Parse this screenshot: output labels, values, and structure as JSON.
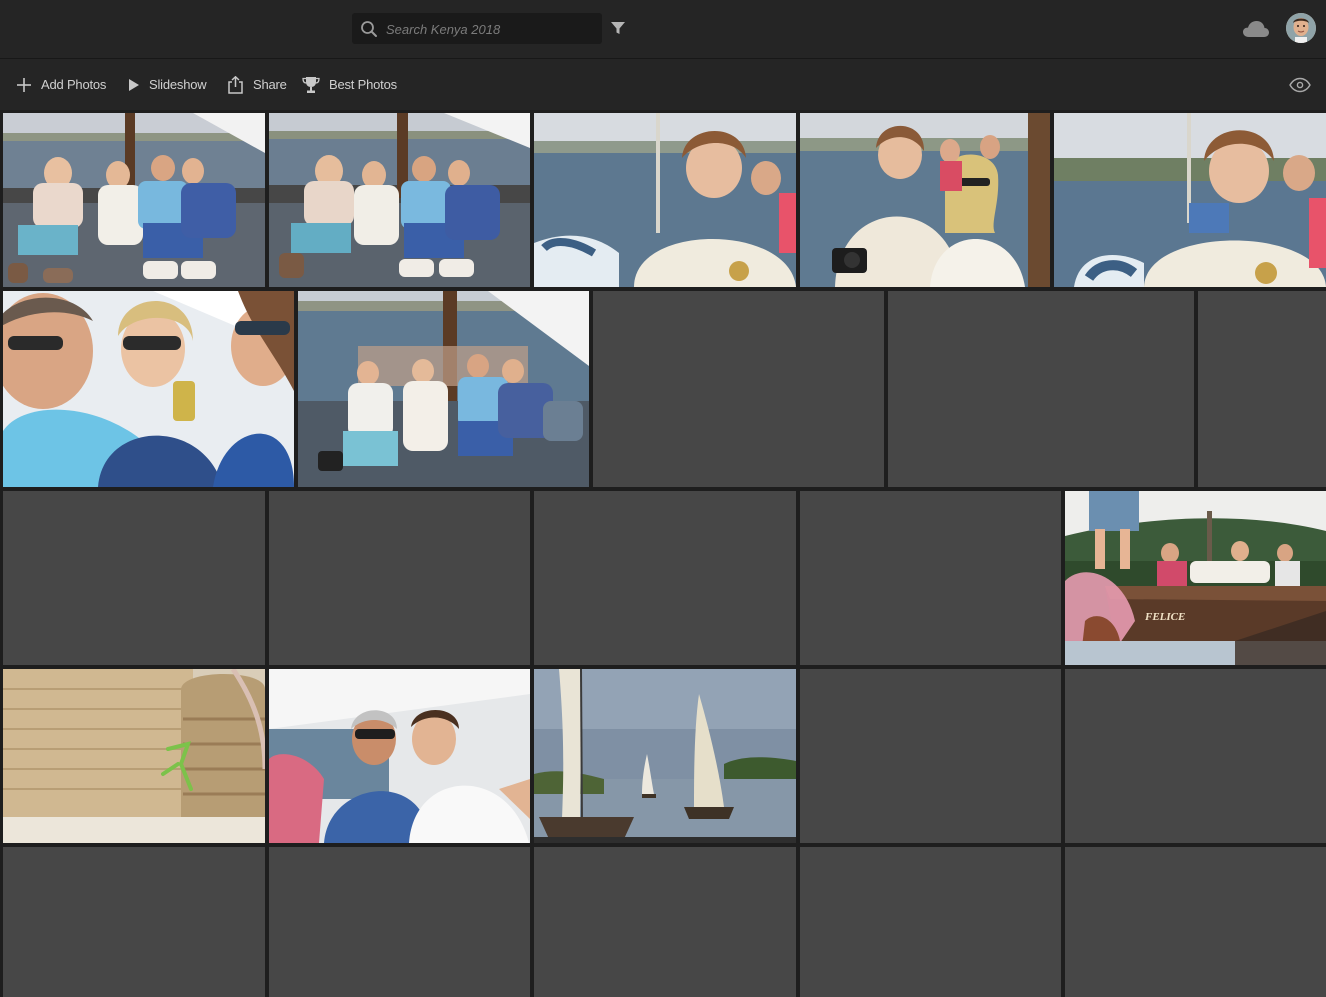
{
  "search": {
    "placeholder": "Search Kenya 2018",
    "value": ""
  },
  "topbar": {
    "filter_icon": "filter-icon",
    "cloud_icon": "cloud-icon",
    "avatar_icon": "user-avatar"
  },
  "toolbar": {
    "add_photos_label": "Add Photos",
    "slideshow_label": "Slideshow",
    "share_label": "Share",
    "best_photos_label": "Best Photos",
    "view_icon": "eye-icon"
  },
  "colors": {
    "background": "#1e1e1e",
    "bar": "#252525",
    "placeholder_tile": "#474747"
  },
  "photos": [
    {
      "subject": "family-on-boat-deck",
      "loaded": true
    },
    {
      "subject": "family-on-boat-deck-2",
      "loaded": true
    },
    {
      "subject": "teen-portrait-sea",
      "loaded": true
    },
    {
      "subject": "teen-and-woman-camera",
      "loaded": true
    },
    {
      "subject": "teen-portrait-sea-2",
      "loaded": true
    },
    {
      "subject": "friends-toast-closeup",
      "loaded": true
    },
    {
      "subject": "group-on-dhow",
      "loaded": true
    },
    {
      "subject": "placeholder",
      "loaded": false
    },
    {
      "subject": "placeholder",
      "loaded": false
    },
    {
      "subject": "placeholder",
      "loaded": false
    },
    {
      "subject": "placeholder",
      "loaded": false
    },
    {
      "subject": "placeholder",
      "loaded": false
    },
    {
      "subject": "placeholder",
      "loaded": false
    },
    {
      "subject": "placeholder",
      "loaded": false
    },
    {
      "subject": "boat-felice",
      "loaded": true
    },
    {
      "subject": "woven-baskets-mantis",
      "loaded": true
    },
    {
      "subject": "two-men-selfie",
      "loaded": true
    },
    {
      "subject": "sailboats-channel",
      "loaded": true
    },
    {
      "subject": "placeholder",
      "loaded": false
    },
    {
      "subject": "placeholder",
      "loaded": false
    },
    {
      "subject": "placeholder",
      "loaded": false
    },
    {
      "subject": "placeholder",
      "loaded": false
    },
    {
      "subject": "placeholder",
      "loaded": false
    },
    {
      "subject": "placeholder",
      "loaded": false
    },
    {
      "subject": "placeholder",
      "loaded": false
    }
  ],
  "boat_name": "FELICE"
}
